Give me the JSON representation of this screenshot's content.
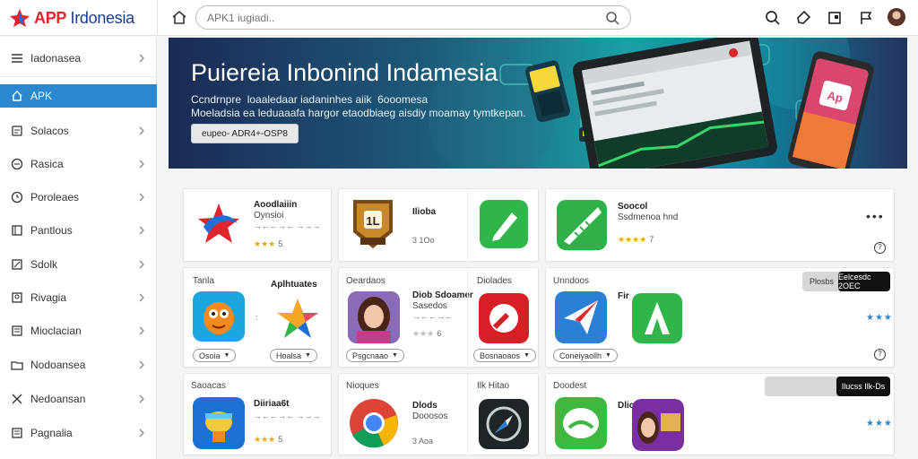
{
  "header": {
    "logo_app": "APP",
    "logo_name": "Irdonesia",
    "search_placeholder": "APK1 iugiadi.."
  },
  "sidebar": {
    "items": [
      {
        "label": "Iadonasea",
        "icon": "menu-icon"
      },
      {
        "label": "APK",
        "icon": "home-icon"
      },
      {
        "label": "Solacos",
        "icon": "phone-icon"
      },
      {
        "label": "Rasica",
        "icon": "globe-icon"
      },
      {
        "label": "Poroleaes",
        "icon": "clock-icon"
      },
      {
        "label": "Pantlous",
        "icon": "tablet-icon"
      },
      {
        "label": "Sdolk",
        "icon": "edit-icon"
      },
      {
        "label": "Rivagia",
        "icon": "person-icon"
      },
      {
        "label": "Mioclacian",
        "icon": "book-icon"
      },
      {
        "label": "Nodoansea",
        "icon": "folder-icon"
      },
      {
        "label": "Nedoansan",
        "icon": "tools-icon"
      },
      {
        "label": "Pagnalia",
        "icon": "list-icon"
      }
    ]
  },
  "banner": {
    "title": "Puiereia Inbonind Indamesia",
    "line1": "Ccndrnpre  loaaledaar iadaninhes aiik  6ooomesa",
    "line2": "Moeladsia ea leduaaafa hargor etaodbiaeg aisdiy moamay tymtkepan.",
    "button": "eupeo- ADR4+-OSP8"
  },
  "cards": {
    "c1": {
      "name": "Aoodlaiiin",
      "sub": "Oynsioi",
      "meta": "→←←→← →→→",
      "rating": "★★★",
      "rating_num": "5"
    },
    "c2": {
      "name": "Ilioba",
      "size": "3 1Oo"
    },
    "c3": {
      "name": "Soocol",
      "sub": "Ssdmenoa hnd",
      "rating": "★★★★",
      "rating_num": "7"
    },
    "c4": {
      "label1": "Tanla",
      "label2": "Aplhtuates",
      "pill1": "Osoia",
      "pill2": "Hoalsa"
    },
    "c5": {
      "label1": "Oeardaos",
      "label2": "Diolades",
      "name": "Diob Sdoamer",
      "sub": "Sasedos",
      "meta": "→←←→←",
      "rating": "★★★",
      "rating_num": "6",
      "pill1": "Psgcnaao",
      "pill2": "Bosnaoaos"
    },
    "c6": {
      "label": "Unndoos",
      "name": "Fir",
      "pill": "Coneiyaollh",
      "btn_gray": "Plosbs",
      "btn_dark": "Eelcesdc 2OEC"
    },
    "c7": {
      "label": "Saoacas",
      "name": "Diiriaa6t",
      "meta": "→←←→← →→→",
      "rating": "★★★",
      "rating_num": "5"
    },
    "c8": {
      "label1": "Nioques",
      "label2": "Ilk Hitao",
      "name": "Dlods",
      "sub": "Dooosos",
      "size": "3 Aoa"
    },
    "c9": {
      "label": "Doodest",
      "name": "Dlio",
      "btn_dark": "Ilucss Ilk-Ds"
    }
  },
  "colors": {
    "accent": "#2d87cf",
    "brand_red": "#e0262b",
    "brand_blue": "#1c3c8c",
    "star": "#f0a400"
  }
}
